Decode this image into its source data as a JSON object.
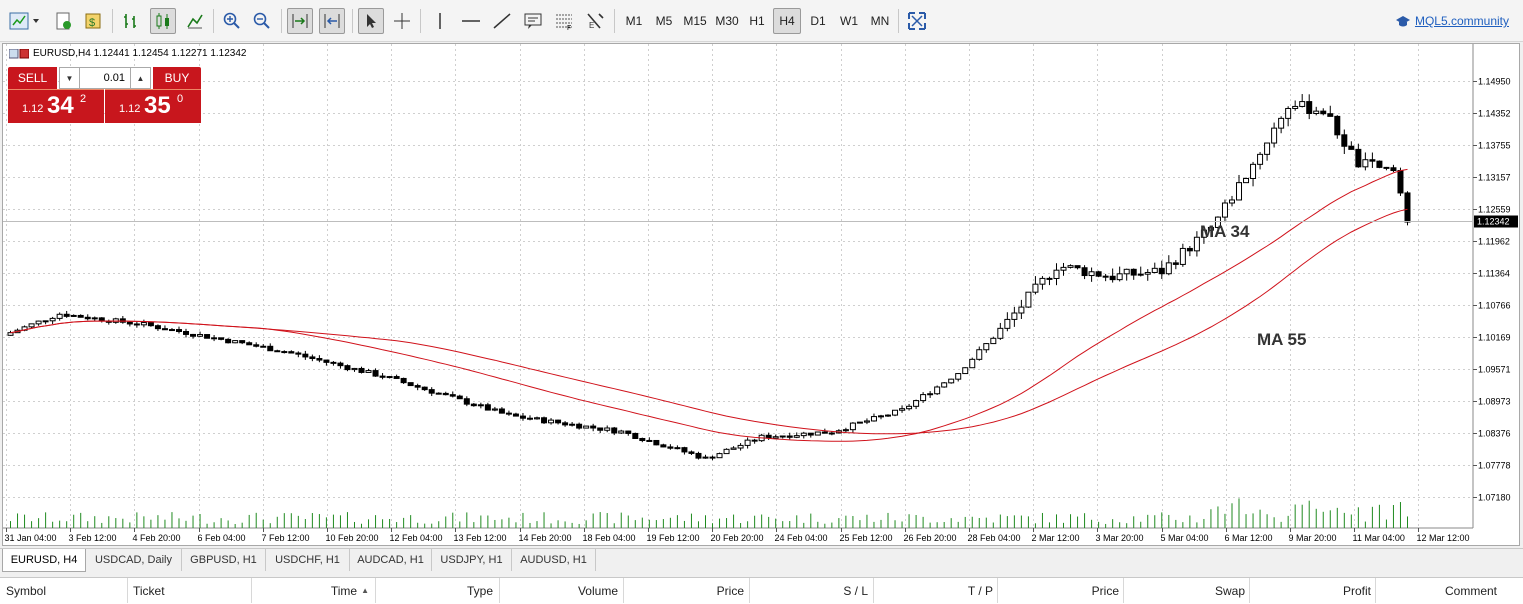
{
  "toolbar": {
    "timeframes": [
      "M1",
      "M5",
      "M15",
      "M30",
      "H1",
      "H4",
      "D1",
      "W1",
      "MN"
    ],
    "active_timeframe": "H4",
    "mql_link": "MQL5.community"
  },
  "chart": {
    "header": "EURUSD,H4  1.12441 1.12454 1.12271 1.12342",
    "symbol": "EURUSD",
    "timeframe": "H4",
    "ohlc": {
      "open": "1.12441",
      "high": "1.12454",
      "low": "1.12271",
      "close": "1.12342"
    },
    "current_price": "1.12342",
    "price_labels": [
      "1.14950",
      "1.14352",
      "1.13755",
      "1.13157",
      "1.12559",
      "1.11962",
      "1.11364",
      "1.10766",
      "1.10169",
      "1.09571",
      "1.08973",
      "1.08376",
      "1.07778",
      "1.07180"
    ],
    "date_labels": [
      "31 Jan 04:00",
      "3 Feb 12:00",
      "4 Feb 20:00",
      "6 Feb 04:00",
      "7 Feb 12:00",
      "10 Feb 20:00",
      "12 Feb 04:00",
      "13 Feb 12:00",
      "14 Feb 20:00",
      "18 Feb 04:00",
      "19 Feb 12:00",
      "20 Feb 20:00",
      "24 Feb 04:00",
      "25 Feb 12:00",
      "26 Feb 20:00",
      "28 Feb 04:00",
      "2 Mar 12:00",
      "3 Mar 20:00",
      "5 Mar 04:00",
      "6 Mar 12:00",
      "9 Mar 20:00",
      "11 Mar 04:00",
      "12 Mar 12:00"
    ],
    "annotations": [
      "MA 34",
      "MA 55"
    ],
    "colors": {
      "ma": "#d0121b",
      "candle": "#000000",
      "volume": "#1f8a1f",
      "grid": "#cfcfcf"
    }
  },
  "trade_panel": {
    "sell_label": "SELL",
    "buy_label": "BUY",
    "lot": "0.01",
    "sell_price": {
      "prefix": "1.12",
      "big": "34",
      "sup": "2"
    },
    "buy_price": {
      "prefix": "1.12",
      "big": "35",
      "sup": "0"
    }
  },
  "tabs": [
    "EURUSD, H4",
    "USDCAD, Daily",
    "GBPUSD, H1",
    "USDCHF, H1",
    "AUDCAD, H1",
    "USDJPY, H1",
    "AUDUSD, H1"
  ],
  "terminal": {
    "columns": [
      "Symbol",
      "Ticket",
      "Time",
      "Type",
      "Volume",
      "Price",
      "S / L",
      "T / P",
      "Price",
      "Swap",
      "Profit",
      "Comment"
    ]
  }
}
